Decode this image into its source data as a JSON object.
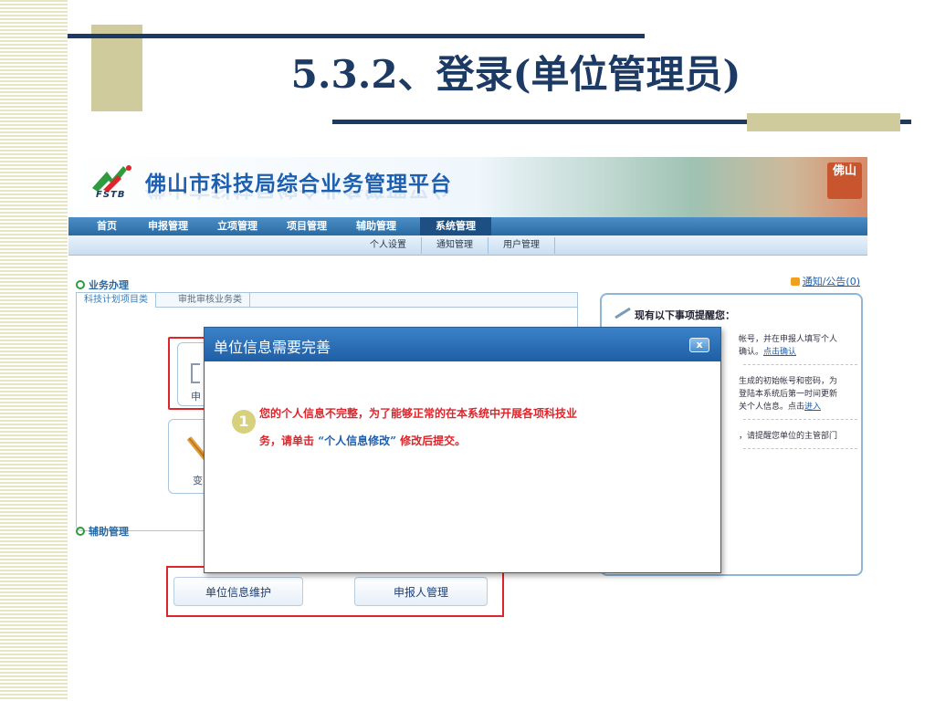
{
  "slide": {
    "title": "5.3.2、登录(单位管理员)"
  },
  "app": {
    "title": "佛山市科技局综合业务管理平台",
    "logo_abbr": "FSTB",
    "banner_seal": "佛山",
    "main_nav": [
      "首页",
      "申报管理",
      "立项管理",
      "项目管理",
      "辅助管理",
      "系统管理"
    ],
    "main_nav_active": "系统管理",
    "sub_nav": [
      "个人设置",
      "通知管理",
      "用户管理"
    ]
  },
  "business": {
    "title": "业务办理",
    "tabs": [
      "科技计划项目类",
      "审批审核业务类"
    ],
    "card1_label": "申",
    "card2_label": "变"
  },
  "auxiliary": {
    "title": "辅助管理",
    "buttons": [
      "单位信息维护",
      "申报人管理"
    ]
  },
  "notice": {
    "link": "通知/公告(0)",
    "heading": "现有以下事项提醒您：",
    "item1_line1": "帐号，并在申报人填写个人",
    "item1_line2_prefix": "确认。",
    "item1_link": "点击确认",
    "item2_line1": "生成的初始帐号和密码，为",
    "item2_line2": "登陆本系统后第一时间更新",
    "item2_line3_prefix": "关个人信息。点击",
    "item2_link": "进入",
    "item3_line1": "，请提醒您单位的主管部门"
  },
  "modal": {
    "title": "单位信息需要完善",
    "close": "x",
    "badge": "1",
    "message_line1": "您的个人信息不完整，为了能够正常的在本系统中开展各项科技业",
    "message_line2_prefix": "务，请单击  ",
    "message_quote": "“个人信息修改”",
    "message_line2_suffix": " 修改后提交。"
  }
}
